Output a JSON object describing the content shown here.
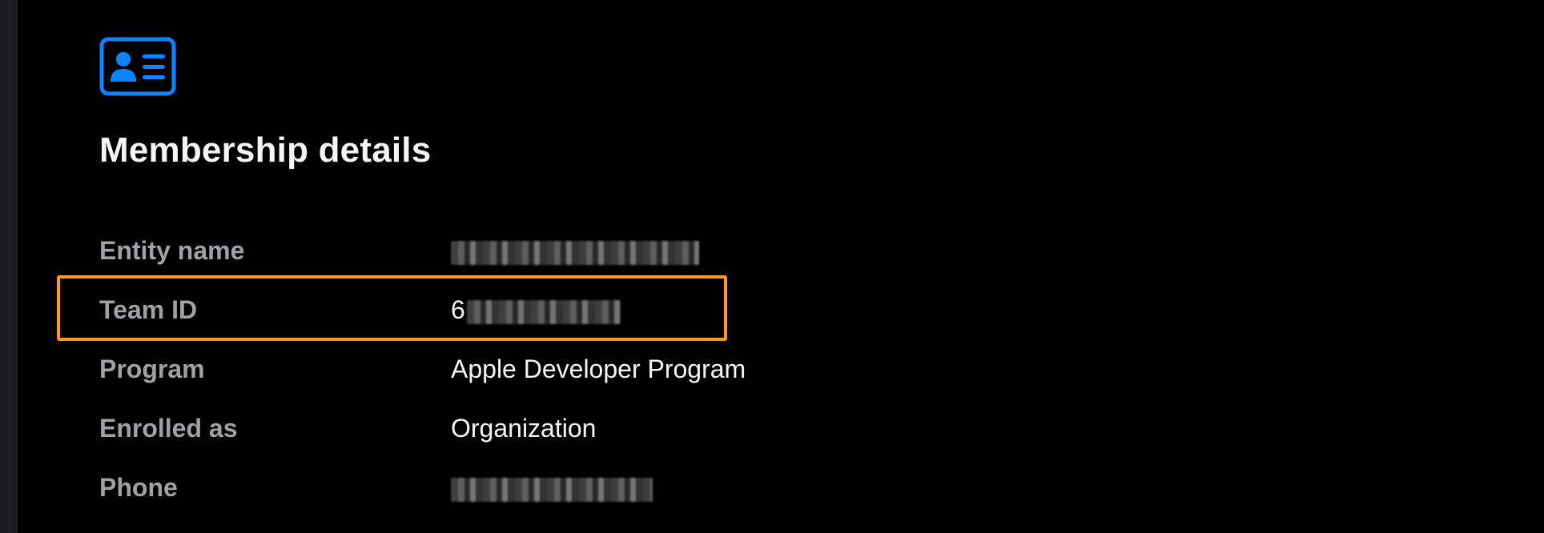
{
  "header": {
    "icon": "contact-card-icon",
    "title": "Membership details"
  },
  "details": [
    {
      "label": "Entity name",
      "value": "",
      "redacted": true
    },
    {
      "label": "Team ID",
      "value_prefix": "6",
      "redacted": true
    },
    {
      "label": "Program",
      "value": "Apple Developer Program"
    },
    {
      "label": "Enrolled as",
      "value": "Organization"
    },
    {
      "label": "Phone",
      "value": "",
      "redacted": true
    }
  ],
  "colors": {
    "background": "#000000",
    "accent_icon": "#0a84ff",
    "highlight": "#ff9a1f",
    "label": "#a1a1a6",
    "value": "#f5f5f7"
  }
}
